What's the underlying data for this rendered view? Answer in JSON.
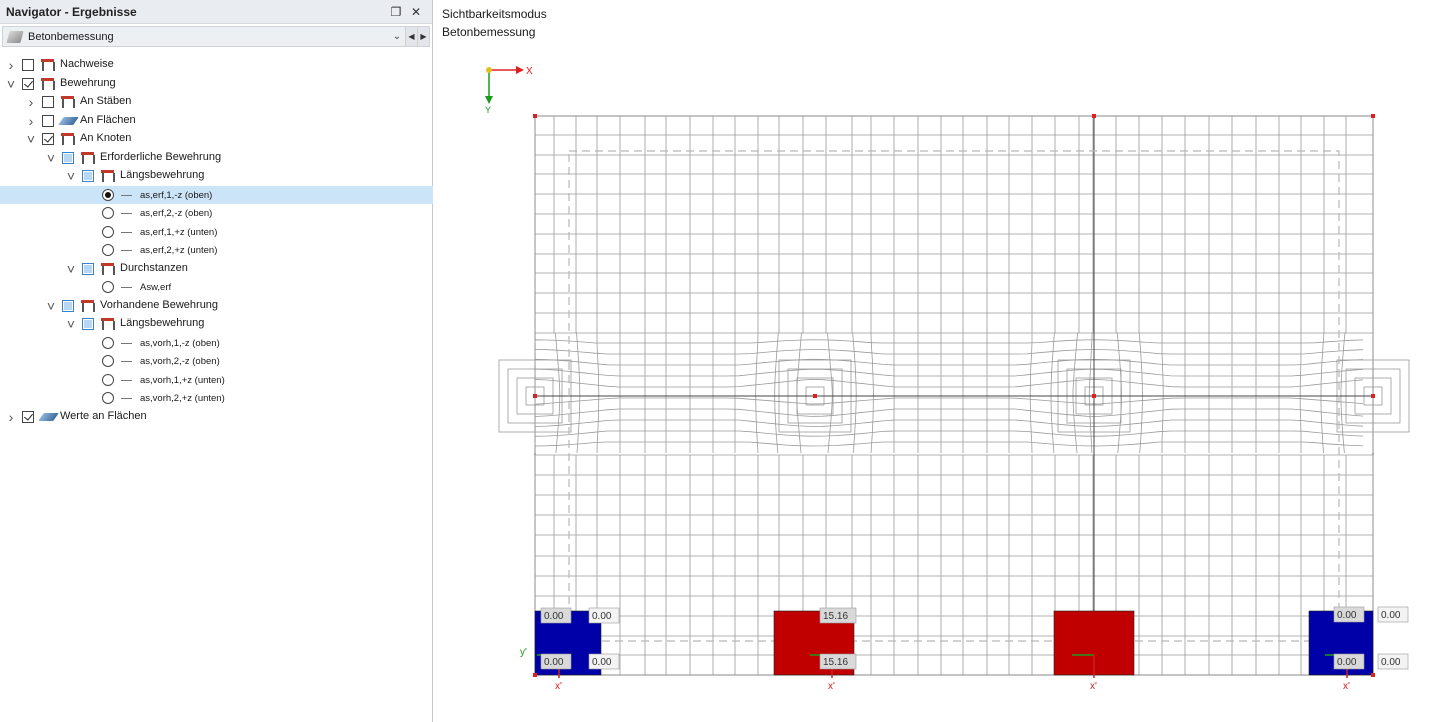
{
  "navigator": {
    "title": "Navigator - Ergebnisse",
    "pin_icon": "pin-icon",
    "close_icon": "close-icon",
    "combo": {
      "selected": "Betonbemessung"
    },
    "tree": [
      {
        "label": "Nachweise",
        "level": 0,
        "expander": "collapsed",
        "control": "check",
        "state": "off",
        "icon": "frame-icon"
      },
      {
        "label": "Bewehrung",
        "level": 0,
        "expander": "expanded",
        "control": "check",
        "state": "on",
        "icon": "frame-icon"
      },
      {
        "label": "An Stäben",
        "level": 1,
        "expander": "collapsed",
        "control": "check",
        "state": "off",
        "icon": "frame-icon"
      },
      {
        "label": "An Flächen",
        "level": 1,
        "expander": "collapsed",
        "control": "check",
        "state": "off",
        "icon": "surface-icon"
      },
      {
        "label": "An Knoten",
        "level": 1,
        "expander": "expanded",
        "control": "check",
        "state": "on",
        "icon": "frame-icon"
      },
      {
        "label": "Erforderliche Bewehrung",
        "level": 2,
        "expander": "expanded",
        "control": "check",
        "state": "partial",
        "icon": "frame-icon"
      },
      {
        "label": "Längsbewehrung",
        "level": 3,
        "expander": "expanded",
        "control": "check",
        "state": "partial",
        "icon": "frame-icon"
      },
      {
        "label": "as,erf,1,-z (oben)",
        "level": 4,
        "expander": "none",
        "control": "radio",
        "state": "on",
        "icon": "line-icon",
        "selected": true
      },
      {
        "label": "as,erf,2,-z (oben)",
        "level": 4,
        "expander": "none",
        "control": "radio",
        "state": "off",
        "icon": "line-icon"
      },
      {
        "label": "as,erf,1,+z (unten)",
        "level": 4,
        "expander": "none",
        "control": "radio",
        "state": "off",
        "icon": "line-icon"
      },
      {
        "label": "as,erf,2,+z (unten)",
        "level": 4,
        "expander": "none",
        "control": "radio",
        "state": "off",
        "icon": "line-icon"
      },
      {
        "label": "Durchstanzen",
        "level": 3,
        "expander": "expanded",
        "control": "check",
        "state": "partial",
        "icon": "frame-icon"
      },
      {
        "label": "Asw,erf",
        "level": 4,
        "expander": "none",
        "control": "radio",
        "state": "off",
        "icon": "line-icon"
      },
      {
        "label": "Vorhandene Bewehrung",
        "level": 2,
        "expander": "expanded",
        "control": "check",
        "state": "partial",
        "icon": "frame-icon"
      },
      {
        "label": "Längsbewehrung",
        "level": 3,
        "expander": "expanded",
        "control": "check",
        "state": "partial",
        "icon": "frame-icon"
      },
      {
        "label": "as,vorh,1,-z (oben)",
        "level": 4,
        "expander": "none",
        "control": "radio",
        "state": "off",
        "icon": "line-icon"
      },
      {
        "label": "as,vorh,2,-z (oben)",
        "level": 4,
        "expander": "none",
        "control": "radio",
        "state": "off",
        "icon": "line-icon"
      },
      {
        "label": "as,vorh,1,+z (unten)",
        "level": 4,
        "expander": "none",
        "control": "radio",
        "state": "off",
        "icon": "line-icon"
      },
      {
        "label": "as,vorh,2,+z (unten)",
        "level": 4,
        "expander": "none",
        "control": "radio",
        "state": "off",
        "icon": "line-icon"
      },
      {
        "label": "Werte an Flächen",
        "level": 0,
        "expander": "collapsed",
        "control": "check",
        "state": "on",
        "icon": "surface-icon"
      }
    ]
  },
  "viewport": {
    "visibility_mode": "Sichtbarkeitsmodus",
    "result_type": "Betonbemessung",
    "axis_x_label": "X",
    "axis_y_label": "Y",
    "local_axis_x": "x'",
    "local_axis_y": "y'",
    "colors": {
      "required_high": "#c00000",
      "zero": "#0000a8",
      "mesh": "#9a9a9a",
      "node": "#e02020"
    },
    "results": [
      {
        "node": "left",
        "values": [
          "0.00",
          "0.00",
          "0.00",
          "0.00"
        ],
        "color": "zero"
      },
      {
        "node": "mid-left",
        "values": [
          "15.16",
          "15.16"
        ],
        "color": "required_high"
      },
      {
        "node": "mid-right",
        "values": [],
        "color": "required_high"
      },
      {
        "node": "right",
        "values": [
          "0.00",
          "0.00",
          "0.00",
          "0.00"
        ],
        "color": "zero"
      }
    ]
  }
}
